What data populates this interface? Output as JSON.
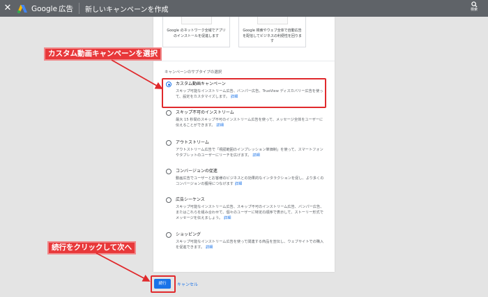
{
  "topbar": {
    "close_icon": "close-icon",
    "brand_google": "Google",
    "brand_ads": "広告",
    "title": "新しいキャンペーンを作成",
    "search_label": "検索"
  },
  "top_cards": [
    {
      "text": "Google のネットワーク全域でアプリのインストールを促進します"
    },
    {
      "text": "Google 検索やウェブ全体で自動広告を配信してビジネスの利便性を回ります"
    }
  ],
  "section_title": "キャンペーンのサブタイプの選択",
  "options": [
    {
      "label": "カスタム動画キャンペーン",
      "desc": "スキップ可能なインストリーム広告、バンパー広告、TrueView ディスカバリー広告を使って、設定をカスタマイズします。",
      "more": "詳細",
      "selected": true
    },
    {
      "label": "スキップ不可のインストリーム",
      "desc": "最大 15 秒間のスキップ不可のインストリーム広告を使って、メッセージ全体をユーザーに伝えることができます。",
      "more": "詳細",
      "selected": false
    },
    {
      "label": "アウトストリーム",
      "desc": "アウトストリーム広告で「視認範囲のインプレッション単価制」を使って、スマートフォンやタブレットのユーザーにリーチを広げます。",
      "more": "詳細",
      "selected": false
    },
    {
      "label": "コンバージョンの促進",
      "desc": "動画広告でユーザーとお客様のビジネスとの効果的なインタラクションを促し、より多くのコンバージョンの獲得につなげます",
      "more": "詳細",
      "selected": false
    },
    {
      "label": "広告シーケンス",
      "desc": "スキップ可能なインストリーム広告、スキップ不可のインストリーム広告、バンパー広告、またはこれらを組み合わせて、個々のユーザーに特定の順序で表示して、ストーリー形式でメッセージを伝えましょう。",
      "more": "詳細",
      "selected": false
    },
    {
      "label": "ショッピング",
      "desc": "スキップ可能なインストリーム広告を使って関連する商品を宣伝し、ウェブサイトでの購入を促進できます。",
      "more": "詳細",
      "selected": false
    }
  ],
  "buttons": {
    "next": "続行",
    "cancel": "キャンセル"
  },
  "annotations": {
    "callout_select": "カスタム動画キャンペーンを選択",
    "callout_next": "続行をクリックして次へ",
    "color": "#e8383a"
  }
}
